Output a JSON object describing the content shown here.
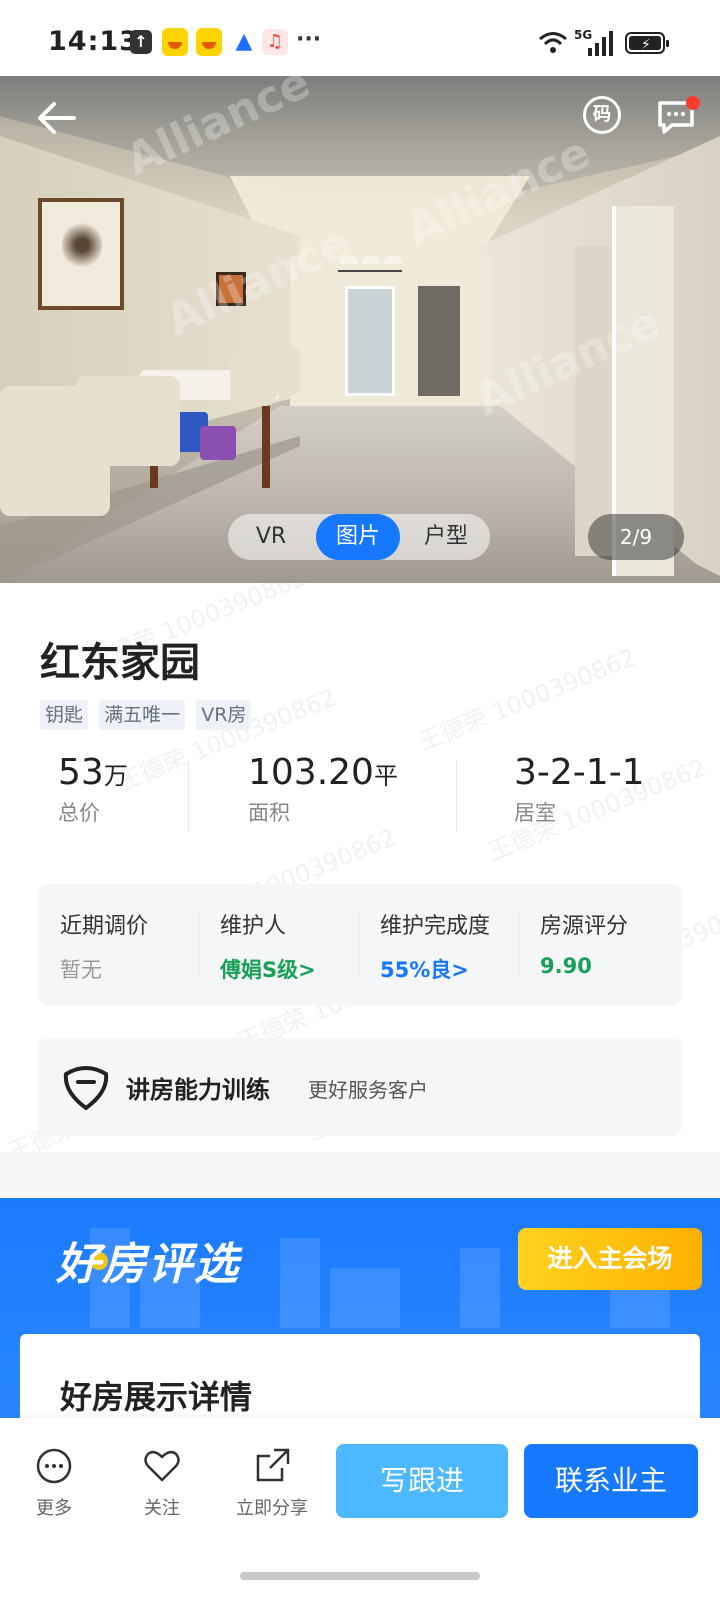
{
  "status_bar": {
    "time": "14:13",
    "network": "5G",
    "icons": [
      "upload-icon",
      "app-icon",
      "app-icon",
      "navigation-icon",
      "music-icon",
      "more-icon",
      "wifi-icon",
      "signal-icon",
      "battery-charging-icon"
    ],
    "more": "···"
  },
  "gallery": {
    "watermark": "Alliance",
    "tabs": [
      "VR",
      "图片",
      "户型"
    ],
    "active_tab": "图片",
    "counter": "2/9",
    "code_button": "码"
  },
  "listing": {
    "title": "红东家园",
    "tags": [
      "钥匙",
      "满五唯一",
      "VR房"
    ],
    "stats": [
      {
        "value": "53",
        "unit": "万",
        "label": "总价"
      },
      {
        "value": "103.20",
        "unit": "平",
        "label": "面积"
      },
      {
        "value": "3-2-1-1",
        "unit": "",
        "label": "居室"
      }
    ],
    "metrics": [
      {
        "label": "近期调价",
        "value": "暂无",
        "color": "#999999"
      },
      {
        "label": "维护人",
        "value": "傅娟S级>",
        "color": "#18a058"
      },
      {
        "label": "维护完成度",
        "value": "55%良>",
        "color": "#1677ff"
      },
      {
        "label": "房源评分",
        "value": "9.90",
        "color": "#18a058"
      }
    ],
    "training": {
      "title": "讲房能力训练",
      "subtitle": "更好服务客户"
    }
  },
  "banner": {
    "logo": "好房评选",
    "button": "进入主会场",
    "card_title": "好房展示详情"
  },
  "page_watermark": "王德荣 1000390862",
  "bottom_bar": {
    "items": [
      {
        "label": "更多",
        "icon": "more-icon"
      },
      {
        "label": "关注",
        "icon": "heart-icon"
      },
      {
        "label": "立即分享",
        "icon": "share-icon"
      }
    ],
    "follow_button": "写跟进",
    "contact_button": "联系业主"
  },
  "colors": {
    "primary": "#1677ff",
    "secondary": "#4cb8ff",
    "green": "#18a058",
    "gold": "#ffb000"
  }
}
